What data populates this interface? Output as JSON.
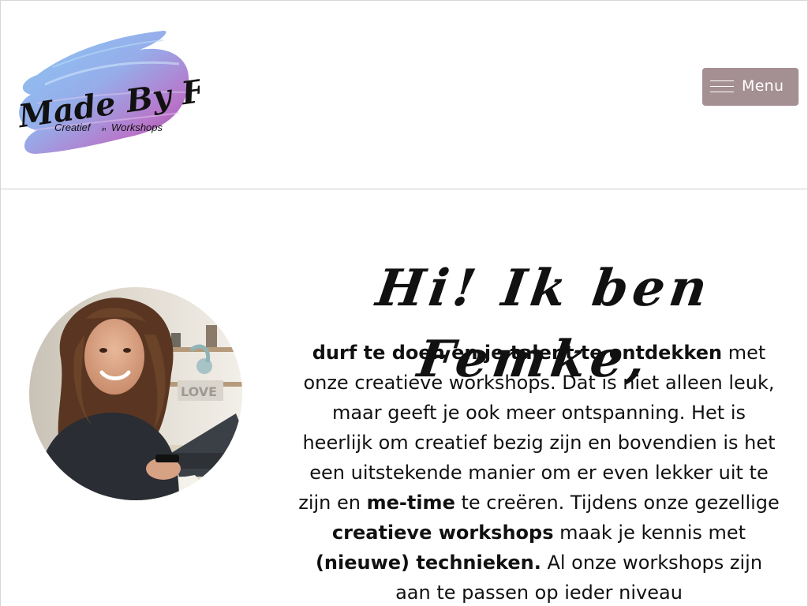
{
  "header": {
    "logo": {
      "title": "Made By Fem",
      "subtitle_left": "Creatief",
      "subtitle_in": "in",
      "subtitle_right": "Workshops"
    },
    "menu_label": "Menu"
  },
  "intro": {
    "portrait_alt": "Femke",
    "greeting": "Hi! Ik ben Femke,",
    "text": {
      "p1_bold": "durf te doen en je talent te ontdekken",
      "p2": " met onze creatieve workshops. Dat is niet alleen leuk, maar geeft je ook meer ontspanning. Het is heerlijk om creatief bezig zijn en bovendien is het een uitstekende manier om er even lekker uit te zijn en ",
      "p3_bold": "me-time",
      "p4": " te creëren. Tijdens onze gezellige ",
      "p5_bold": "creatieve workshops",
      "p6": " maak je kennis met ",
      "p7_bold": "(nieuwe) technieken.",
      "p8": " Al onze workshops zijn aan te passen op ieder niveau"
    }
  },
  "colors": {
    "menu_bg": "#a48f93",
    "logo_blue": "#5aa9e6",
    "logo_purple": "#9a3fa6"
  }
}
